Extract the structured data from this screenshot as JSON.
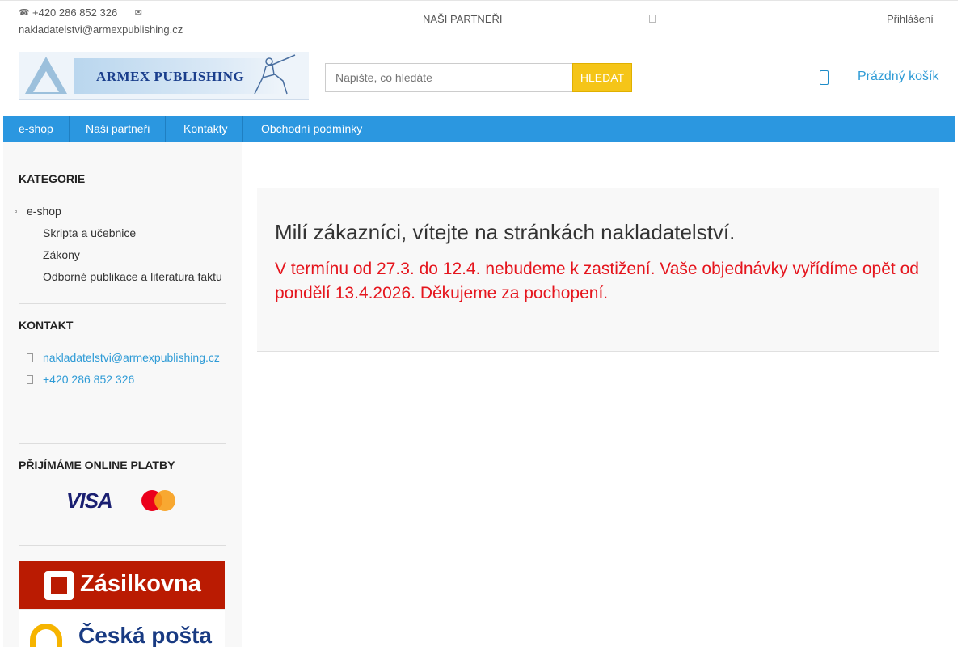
{
  "topbar": {
    "phone": "+420 286 852 326",
    "email": "nakladatelstvi@armexpublishing.cz",
    "partners": "NAŠI PARTNEŘI",
    "login": "Přihlášení"
  },
  "header": {
    "logo_text": "ARMEX PUBLISHING",
    "search_placeholder": "Napište, co hledáte",
    "search_button": "HLEDAT",
    "cart_label": "Prázdný košík"
  },
  "nav": {
    "items": [
      {
        "label": "e-shop"
      },
      {
        "label": "Naši partneři"
      },
      {
        "label": "Kontakty"
      },
      {
        "label": "Obchodní podmínky"
      }
    ]
  },
  "sidebar": {
    "categories_heading": "KATEGORIE",
    "categories_root": "e-shop",
    "categories": [
      {
        "label": "Skripta a učebnice"
      },
      {
        "label": "Zákony"
      },
      {
        "label": "Odborné publikace a literatura faktu"
      }
    ],
    "contact_heading": "KONTAKT",
    "contact_email": "nakladatelstvi@armexpublishing.cz",
    "contact_phone": "+420 286 852 326",
    "payments_heading": "PŘIJÍMÁME ONLINE PLATBY",
    "visa": "VISA",
    "zasilkovna": "Zásilkovna",
    "posta": "Česká pošta"
  },
  "main": {
    "title": "Milí zákazníci, vítejte na stránkách nakladatelství.",
    "notice": "V termínu od 27.3. do 12.4. nebudeme k zastižení. Vaše objednávky vyřídíme opět od pondělí 13.4.2026. Děkujeme za pochopení."
  },
  "colors": {
    "nav_bg": "#2b97e0",
    "search_button": "#f5c518",
    "notice": "#e5151d",
    "link": "#2e9bd6"
  }
}
